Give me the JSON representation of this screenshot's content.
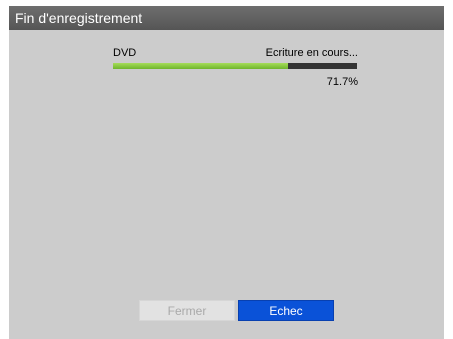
{
  "window": {
    "title": "Fin d'enregistrement"
  },
  "progress": {
    "device_label": "DVD",
    "status_text": "Ecriture en cours...",
    "percent_text": "71.7%",
    "fraction": 0.717,
    "fill_color": "#8ccf3f",
    "track_color": "#333333"
  },
  "buttons": {
    "close_label": "Fermer",
    "close_enabled": false,
    "fail_label": "Echec",
    "fail_color": "#0a52d8"
  }
}
